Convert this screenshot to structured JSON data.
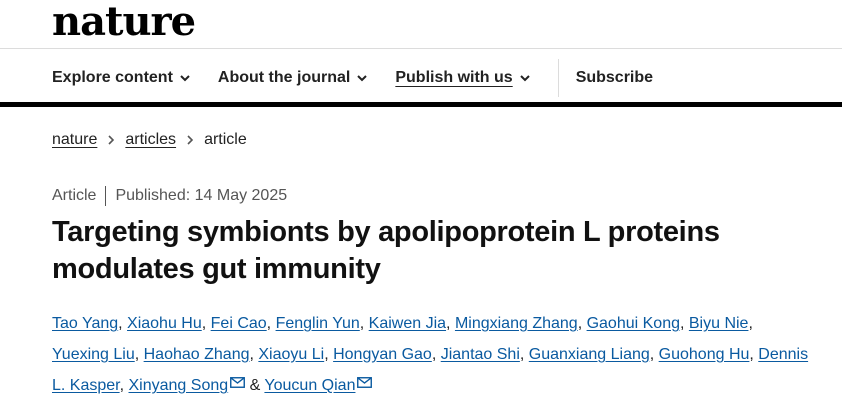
{
  "brand": {
    "logo": "nature"
  },
  "nav": {
    "items": [
      {
        "label": "Explore content",
        "dropdown": true,
        "underline": false
      },
      {
        "label": "About the journal",
        "dropdown": true,
        "underline": false
      },
      {
        "label": "Publish with us",
        "dropdown": true,
        "underline": true
      }
    ],
    "subscribe": "Subscribe"
  },
  "breadcrumb": {
    "items": [
      "nature",
      "articles"
    ],
    "current": "article"
  },
  "article": {
    "type": "Article",
    "published": "Published: 14 May 2025",
    "title": "Targeting symbionts by apolipoprotein L proteins modulates gut immunity"
  },
  "authors": [
    {
      "name": "Tao Yang",
      "sep": ", "
    },
    {
      "name": "Xiaohu Hu",
      "sep": ", "
    },
    {
      "name": "Fei Cao",
      "sep": ", "
    },
    {
      "name": "Fenglin Yun",
      "sep": ", "
    },
    {
      "name": "Kaiwen Jia",
      "sep": ", "
    },
    {
      "name": "Mingxiang Zhang",
      "sep": ", "
    },
    {
      "name": "Gaohui Kong",
      "sep": ", "
    },
    {
      "name": "Biyu Nie",
      "sep": ", "
    },
    {
      "name": "Yuexing Liu",
      "sep": ", "
    },
    {
      "name": "Haohao Zhang",
      "sep": ", "
    },
    {
      "name": "Xiaoyu Li",
      "sep": ", "
    },
    {
      "name": "Hongyan Gao",
      "sep": ", "
    },
    {
      "name": "Jiantao Shi",
      "sep": ", "
    },
    {
      "name": "Guanxiang Liang",
      "sep": ", "
    },
    {
      "name": "Guohong Hu",
      "sep": ", "
    },
    {
      "name": "Dennis L. Kasper",
      "sep": ", "
    },
    {
      "name": "Xinyang Song",
      "email": true,
      "sep": " & "
    },
    {
      "name": "Youcun Qian",
      "email": true,
      "sep": ""
    }
  ]
}
